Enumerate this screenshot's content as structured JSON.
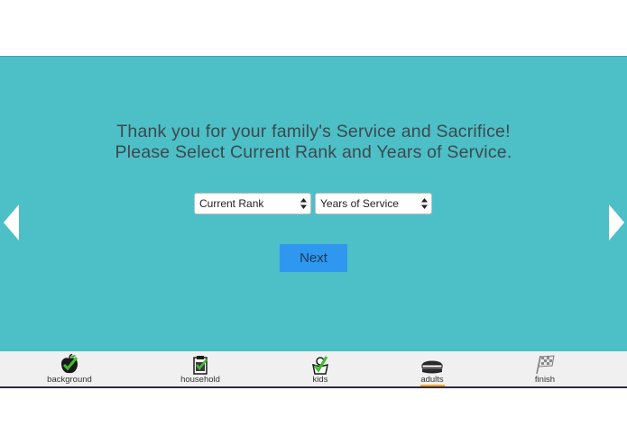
{
  "colors": {
    "panel": "#4dbfc6",
    "next_button": "#2e97f0",
    "bottom_bar": "#f0f0f0",
    "active_underline": "#f0a531",
    "bottom_border": "#2c2a48"
  },
  "headline": {
    "line1": "Thank you for your family's Service and Sacrifice!",
    "line2": "Please Select Current Rank and Years of Service."
  },
  "form": {
    "rank_select": {
      "selected": "Current Rank"
    },
    "years_select": {
      "selected": "Years of Service"
    },
    "next_label": "Next"
  },
  "navigation": {
    "prev_icon": "triangle-left",
    "next_icon": "triangle-right"
  },
  "steps": [
    {
      "label": "background",
      "icon": "apple-check-icon",
      "active": false
    },
    {
      "label": "household",
      "icon": "clipboard-check-icon",
      "active": false
    },
    {
      "label": "kids",
      "icon": "kids-check-icon",
      "active": false
    },
    {
      "label": "adults",
      "icon": "sandwich-icon",
      "active": true
    },
    {
      "label": "finish",
      "icon": "checkered-flag-icon",
      "active": false
    }
  ]
}
